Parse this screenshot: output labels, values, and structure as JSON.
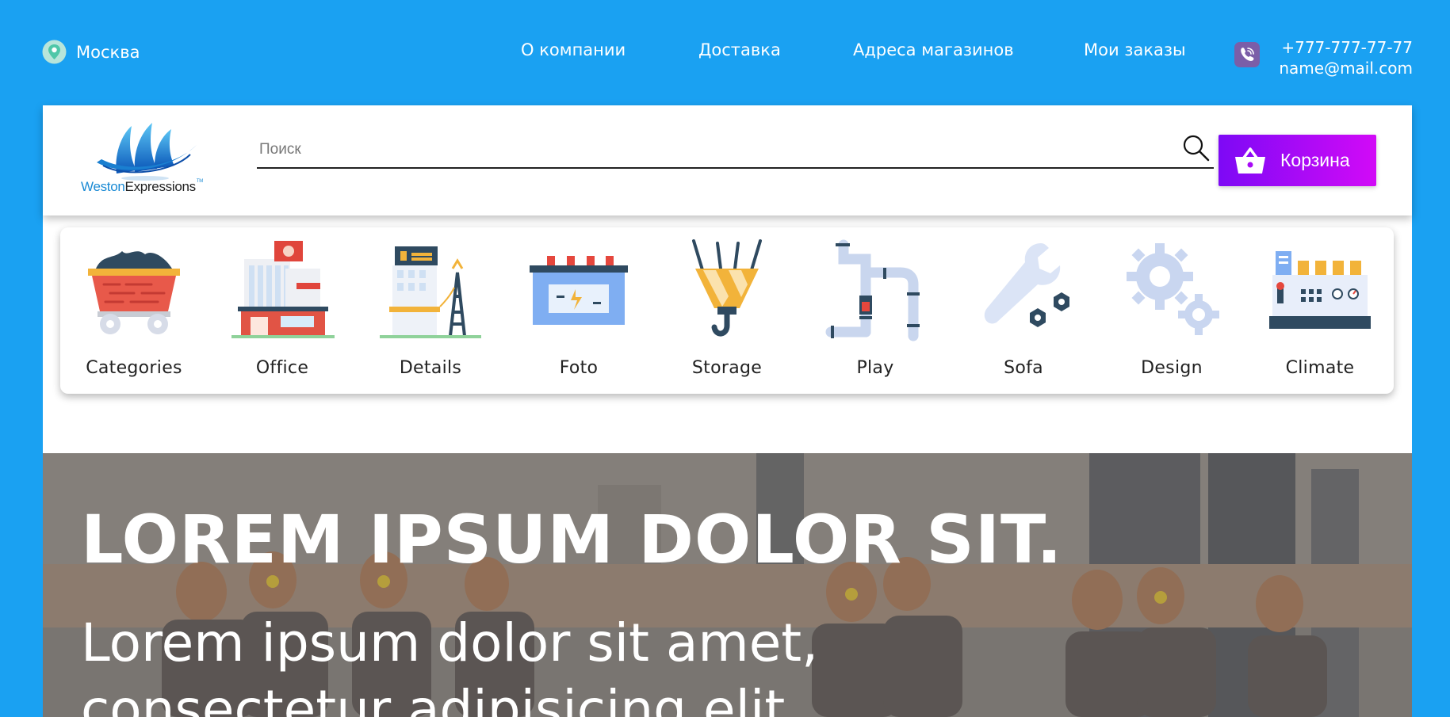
{
  "topbar": {
    "city": "Москва",
    "nav": [
      {
        "label": "О компании"
      },
      {
        "label": "Доставка"
      },
      {
        "label": "Адреса магазинов"
      },
      {
        "label": "Мои заказы"
      }
    ],
    "phone": "+777-777-77-77",
    "email": "name@mail.com"
  },
  "header": {
    "logo": {
      "part1": "Weston",
      "part2": "Expressions",
      "mark": "TM"
    },
    "search": {
      "placeholder": "Поиск",
      "value": ""
    },
    "cart_label": "Корзина"
  },
  "categories": [
    {
      "label": "Categories",
      "icon": "mine-cart-icon"
    },
    {
      "label": "Office",
      "icon": "office-building-icon"
    },
    {
      "label": "Details",
      "icon": "power-plant-icon"
    },
    {
      "label": "Foto",
      "icon": "battery-icon"
    },
    {
      "label": "Storage",
      "icon": "crane-hook-icon"
    },
    {
      "label": "Play",
      "icon": "pipes-icon"
    },
    {
      "label": "Sofa",
      "icon": "wrench-nuts-icon"
    },
    {
      "label": "Design",
      "icon": "gears-icon"
    },
    {
      "label": "Climate",
      "icon": "control-panel-icon"
    }
  ],
  "hero": {
    "title": "LOREM IPSUM DOLOR SIT.",
    "subtitle_line1": "Lorem ipsum dolor sit amet,",
    "subtitle_line2": "consectetur adipisicing elit."
  },
  "colors": {
    "background": "#1aa1f2",
    "cart_gradient_start": "#7d09f5",
    "cart_gradient_end": "#d20af7",
    "viber": "#7b5ea8",
    "pin": "#4fc7a8"
  }
}
